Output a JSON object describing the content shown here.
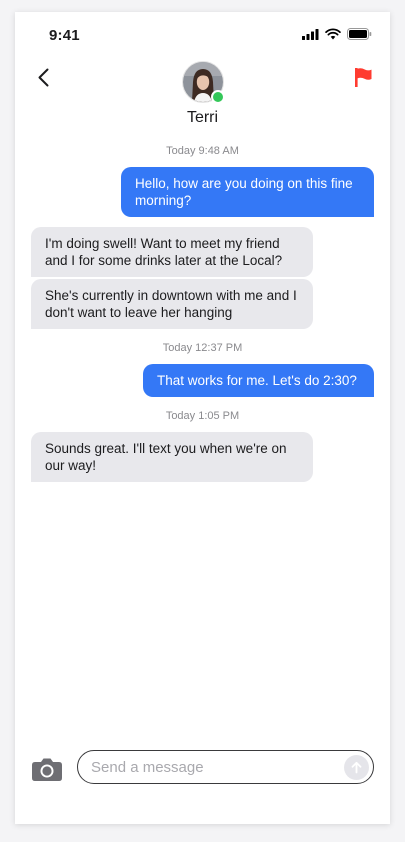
{
  "status_bar": {
    "time": "9:41"
  },
  "header": {
    "contact_name": "Terri",
    "online": true,
    "icons": {
      "back": "chevron-left-icon",
      "flag": "flag-icon",
      "avatar": "profile-photo"
    },
    "colors": {
      "flag": "#ff3b30",
      "online": "#34c759"
    }
  },
  "conversation": {
    "timestamps": [
      "Today 9:48 AM",
      "Today 12:37 PM",
      "Today 1:05 PM"
    ],
    "messages": [
      {
        "direction": "outgoing",
        "text": "Hello, how are you doing on this fine morning?"
      },
      {
        "direction": "incoming",
        "text": "I'm doing swell! Want to meet my friend and I for some drinks later at the Local?"
      },
      {
        "direction": "incoming",
        "text": "She's currently in downtown with me and I don't want to leave her hanging"
      },
      {
        "direction": "outgoing",
        "text": "That works for me. Let's do 2:30?"
      },
      {
        "direction": "incoming",
        "text": "Sounds great. I'll text you when we're on our way!"
      }
    ],
    "colors": {
      "outgoing_bubble": "#3478f6",
      "incoming_bubble": "#e8e8ec"
    }
  },
  "composer": {
    "placeholder": "Send a message",
    "value": "",
    "icons": {
      "camera": "camera-icon",
      "send": "arrow-up-icon"
    }
  }
}
